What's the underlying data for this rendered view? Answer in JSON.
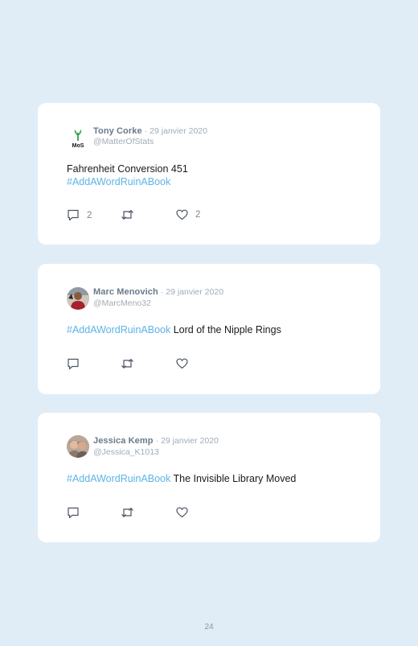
{
  "tweets": [
    {
      "name": "Tony Corke",
      "date": "· 29 janvier 2020",
      "handle": "@MatterOfStats",
      "avatar": "mos-logo",
      "avatar_text": "MoS",
      "line1": "Fahrenheit Conversion 451",
      "line2": "#AddAWordRuinABook",
      "reply_count": "2",
      "retweet_count": "",
      "like_count": "2"
    },
    {
      "name": "Marc Menovich",
      "date": "· 29 janvier 2020",
      "handle": "@MarcMeno32",
      "avatar": "person-photo",
      "hashtag": "#AddAWordRuinABook",
      "text": " Lord of the Nipple Rings",
      "reply_count": "",
      "retweet_count": "",
      "like_count": ""
    },
    {
      "name": "Jessica Kemp",
      "date": "· 29 janvier 2020",
      "handle": "@Jessica_K1013",
      "avatar": "couple-photo",
      "hashtag": "#AddAWordRuinABook",
      "text": " The Invisible Library Moved",
      "reply_count": "",
      "retweet_count": "",
      "like_count": ""
    }
  ],
  "page_number": "24",
  "icons": [
    "reply-icon",
    "retweet-icon",
    "like-icon"
  ],
  "colors": {
    "background": "#e1edf6",
    "card": "#ffffff",
    "hashtag": "#5bb4e5",
    "name": "#6a7a8a",
    "muted": "#a0acb8"
  }
}
